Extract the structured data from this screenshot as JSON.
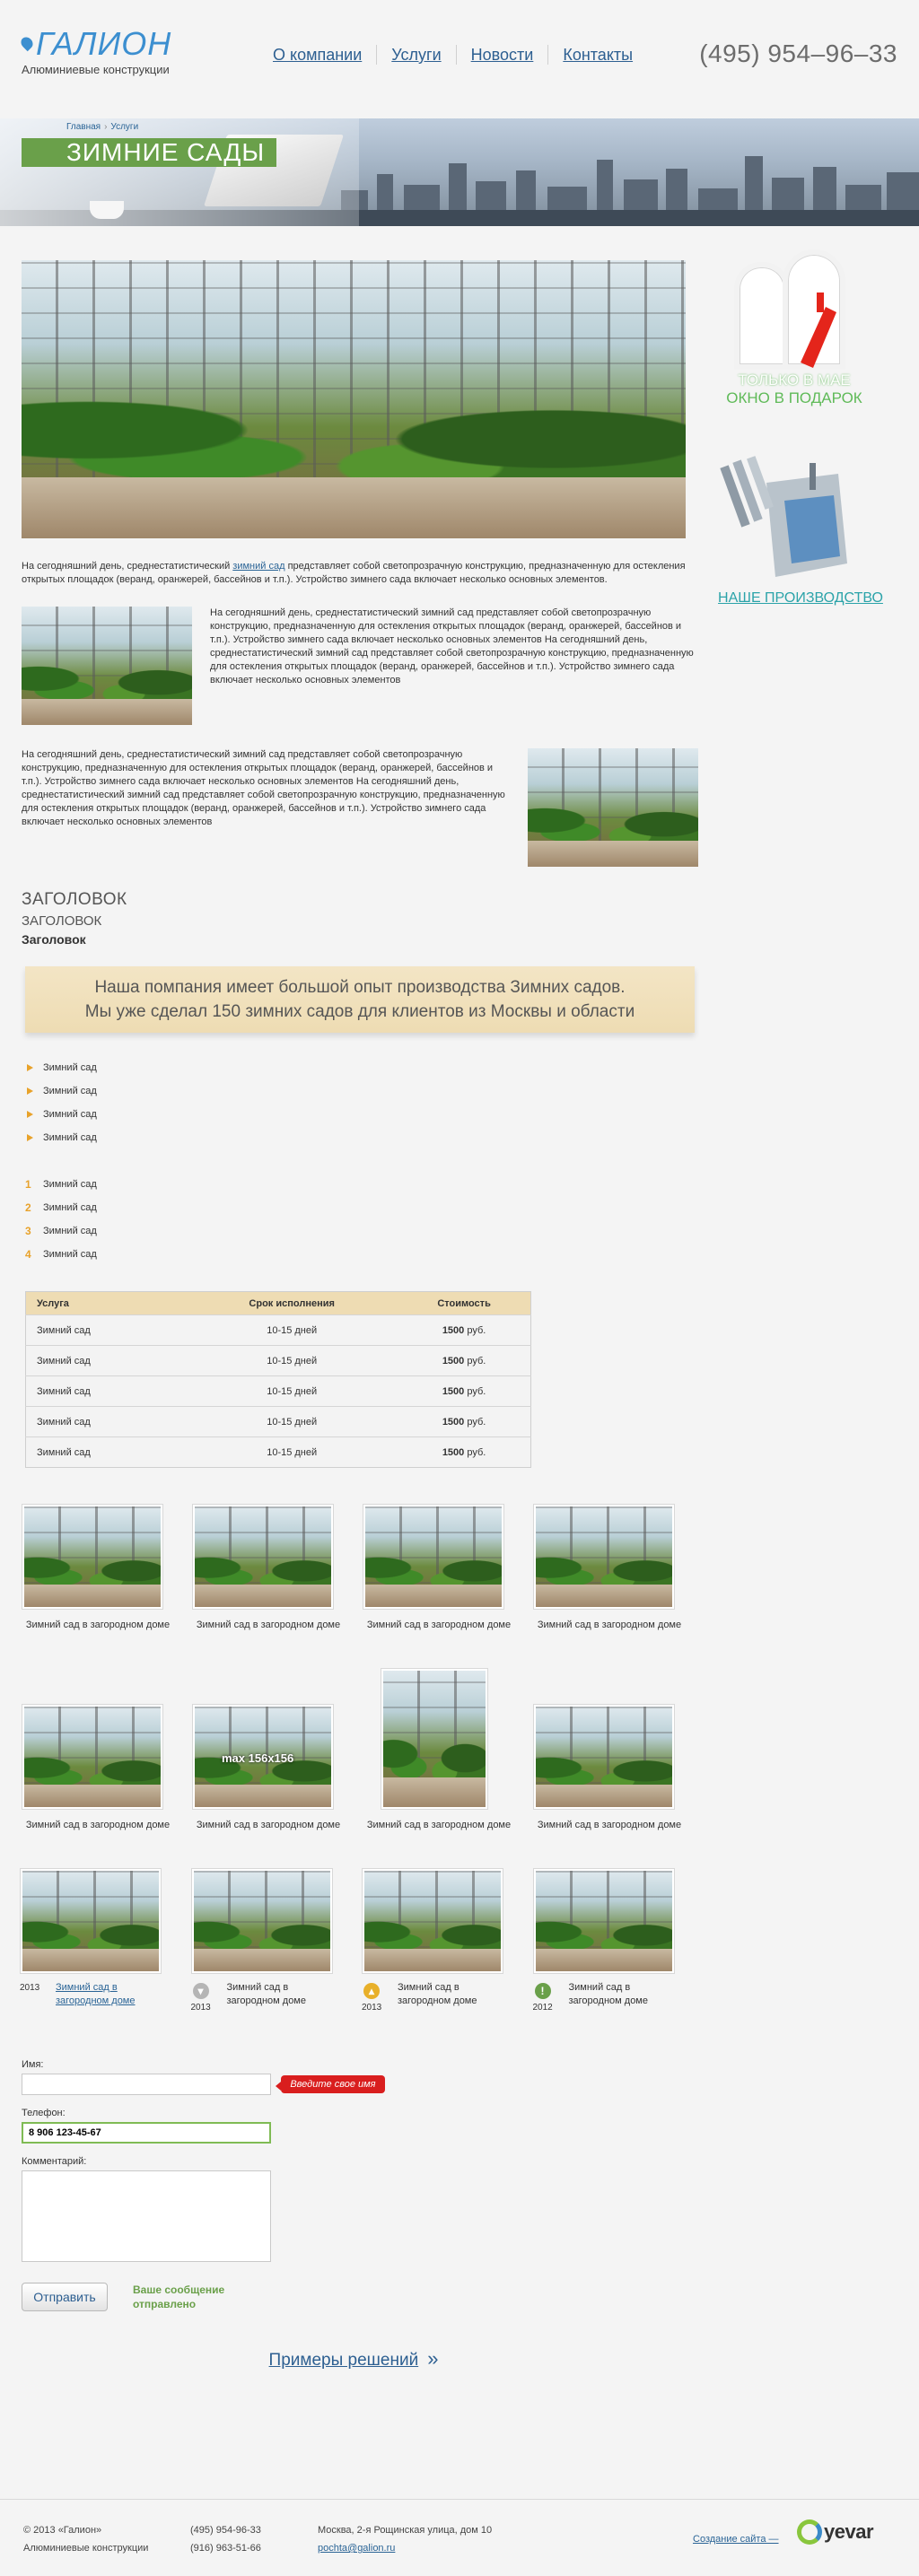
{
  "header": {
    "logo_text": "ГАЛИОН",
    "tagline": "Алюминиевые конструкции",
    "nav": [
      "О компании",
      "Услуги",
      "Новости",
      "Контакты"
    ],
    "phone": "(495) 954–96–33"
  },
  "banner": {
    "breadcrumb": [
      "Главная",
      "Услуги"
    ],
    "title": "ЗИМНИЕ САДЫ"
  },
  "content": {
    "intro_link": "зимний сад",
    "intro_before": "На сегодняшний день, среднестатистический ",
    "intro_after": " представляет собой светопрозрачную конструкцию, предназначенную для остекления открытых площадок (веранд, оранжерей, бассейнов и т.п.). Устройство зимнего сада включает несколько основных элементов.",
    "para_left_img": "На сегодняшний день, среднестатистический зимний сад представляет собой светопрозрачную конструкцию, предназначенную для остекления открытых площадок (веранд, оранжерей, бассейнов и т.п.). Устройство зимнего сада включает несколько основных элементов На сегодняшний день, среднестатистический зимний сад представляет собой светопрозрачную конструкцию, предназначенную для остекления открытых площадок (веранд, оранжерей, бассейнов и т.п.). Устройство зимнего сада включает несколько основных элементов",
    "para_right_img": "На сегодняшний день, среднестатистический зимний сад представляет собой светопрозрачную конструкцию, предназначенную для остекления открытых площадок (веранд, оранжерей, бассейнов и т.п.). Устройство зимнего сада включает несколько основных элементов На сегодняшний день, среднестатистический зимний сад представляет собой светопрозрачную конструкцию, предназначенную для остекления открытых площадок (веранд, оранжерей, бассейнов и т.п.). Устройство зимнего сада включает несколько основных элементов",
    "heading1": "ЗАГОЛОВОК",
    "heading2": "ЗАГОЛОВОК",
    "heading3": "Заголовок",
    "quote_line1": "Наша помпания имеет большой опыт производства Зимних садов.",
    "quote_line2": "Мы уже сделал 150 зимних садов для клиентов из Москвы и области",
    "bullets": [
      "Зимний сад",
      "Зимний сад",
      "Зимний сад",
      "Зимний сад"
    ],
    "numbered": [
      {
        "n": "1",
        "text": "Зимний сад"
      },
      {
        "n": "2",
        "text": "Зимний сад"
      },
      {
        "n": "3",
        "text": "Зимний сад"
      },
      {
        "n": "4",
        "text": "Зимний сад"
      }
    ]
  },
  "table": {
    "headers": [
      "Услуга",
      "Срок исполнения",
      "Стоимость"
    ],
    "rows": [
      [
        "Зимний сад",
        "10-15 дней",
        "1500",
        "руб."
      ],
      [
        "Зимний сад",
        "10-15 дней",
        "1500",
        "руб."
      ],
      [
        "Зимний сад",
        "10-15 дней",
        "1500",
        "руб."
      ],
      [
        "Зимний сад",
        "10-15 дней",
        "1500",
        "руб."
      ],
      [
        "Зимний сад",
        "10-15 дней",
        "1500",
        "руб."
      ]
    ]
  },
  "gallery": {
    "caption": "Зимний сад в загородном доме",
    "max_label": "max 156x156"
  },
  "gallery2": [
    {
      "year": "2013",
      "caption": "Зимний сад в загородном доме",
      "link": true,
      "badge": ""
    },
    {
      "year": "2013",
      "caption": "Зимний сад в загородном доме",
      "link": false,
      "badge": "gray"
    },
    {
      "year": "2013",
      "caption": "Зимний сад в загородном доме",
      "link": false,
      "badge": "yellow"
    },
    {
      "year": "2012",
      "caption": "Зимний сад в загородном доме",
      "link": false,
      "badge": "green"
    }
  ],
  "form": {
    "name_label": "Имя:",
    "name_value": "",
    "name_error": "Введите свое имя",
    "phone_label": "Телефон:",
    "phone_value": "8 906 123-45-67",
    "comment_label": "Комментарий:",
    "comment_value": "",
    "submit": "Отправить",
    "success": "Ваше сообщение отправлено"
  },
  "more_link": "Примеры решений",
  "sidebar": {
    "promo1_line1": "ТОЛЬКО В МАЕ",
    "promo1_line2": "ОКНО В ПОДАРОК",
    "promo2": "НАШЕ ПРОИЗВОДСТВО"
  },
  "footer": {
    "copyright": "© 2013 «Галион»",
    "company": "Алюминиевые конструкции",
    "phone1": "(495) 954-96-33",
    "phone2": "(916) 963-51-66",
    "address": "Москва, 2-я Рощинская улица, дом 10",
    "email": "pochta@galion.ru",
    "site_credit": "Создание сайта —",
    "dev_logo": "yevar"
  },
  "colors": {
    "accent_green": "#6aa04a",
    "link_blue": "#2d5f91",
    "bullet_orange": "#e8a22a",
    "error_red": "#d91e1e",
    "teal": "#2ba3a9"
  }
}
